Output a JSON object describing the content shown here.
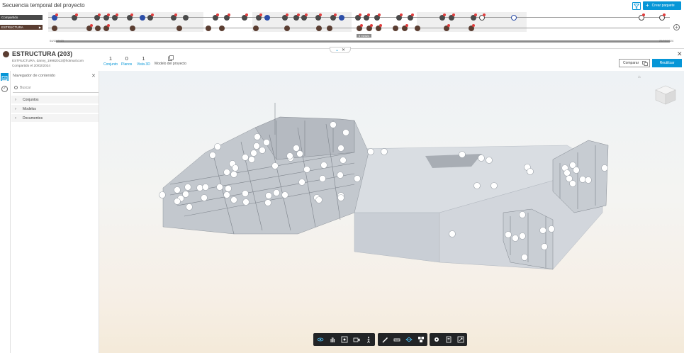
{
  "header": {
    "title": "Secuencia temporal del proyecto",
    "create_button": "Crear paquete"
  },
  "timeline": {
    "tracks": [
      {
        "label": "Compartido",
        "color": "#4a4a4a"
      },
      {
        "label": "ESTRUCTURA",
        "color": "#5a3d31"
      }
    ],
    "start_date": "04/10/2023",
    "end_date": "26/03/2024",
    "zoom_label": "6 meses"
  },
  "package": {
    "title": "ESTRUCTURA (203)",
    "subtitle": "ESTRUCTURA, danny_19982012@hotmail.com",
    "shared": "Compartido el 20/02/2024",
    "stats": [
      {
        "num": "1",
        "label": "Conjunto"
      },
      {
        "num": "0",
        "label": "Planos"
      },
      {
        "num": "1",
        "label": "Vista 3D"
      }
    ],
    "model_label": "Modelo del proyecto",
    "compare_button": "Comparar",
    "reuse_button": "Reutilizar"
  },
  "navigator": {
    "title": "Navegador de contenido",
    "search_placeholder": "Buscar",
    "items": [
      {
        "label": "Conjuntos"
      },
      {
        "label": "Modelos"
      },
      {
        "label": "Documentos"
      }
    ]
  },
  "toolbar": {
    "groups": [
      [
        "orbit-icon",
        "pan-icon",
        "fit-icon",
        "camera-icon",
        "walk-icon"
      ],
      [
        "markup-icon",
        "measure-icon",
        "section-icon",
        "explode-icon"
      ],
      [
        "settings-icon",
        "properties-icon",
        "fullscreen-icon"
      ]
    ]
  },
  "colors": {
    "accent": "#0696d7",
    "shared_track": "#4a4a4a",
    "structure_track": "#5a3d31",
    "dot_blue": "#2c4ea8",
    "badge_red": "#e03e3e"
  }
}
